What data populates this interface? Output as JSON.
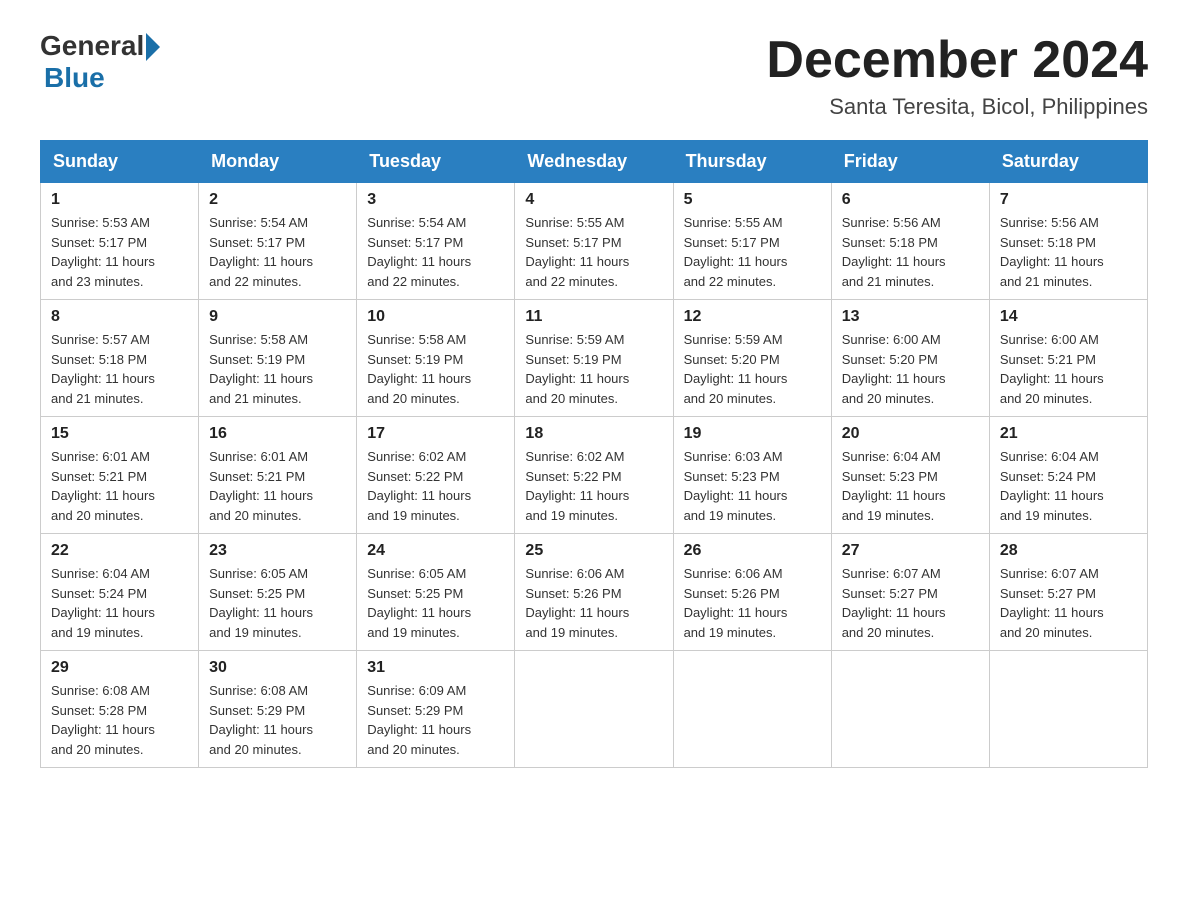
{
  "logo": {
    "general": "General",
    "blue": "Blue"
  },
  "title": "December 2024",
  "subtitle": "Santa Teresita, Bicol, Philippines",
  "days_of_week": [
    "Sunday",
    "Monday",
    "Tuesday",
    "Wednesday",
    "Thursday",
    "Friday",
    "Saturday"
  ],
  "weeks": [
    [
      {
        "day": "1",
        "sunrise": "5:53 AM",
        "sunset": "5:17 PM",
        "daylight": "11 hours and 23 minutes."
      },
      {
        "day": "2",
        "sunrise": "5:54 AM",
        "sunset": "5:17 PM",
        "daylight": "11 hours and 22 minutes."
      },
      {
        "day": "3",
        "sunrise": "5:54 AM",
        "sunset": "5:17 PM",
        "daylight": "11 hours and 22 minutes."
      },
      {
        "day": "4",
        "sunrise": "5:55 AM",
        "sunset": "5:17 PM",
        "daylight": "11 hours and 22 minutes."
      },
      {
        "day": "5",
        "sunrise": "5:55 AM",
        "sunset": "5:17 PM",
        "daylight": "11 hours and 22 minutes."
      },
      {
        "day": "6",
        "sunrise": "5:56 AM",
        "sunset": "5:18 PM",
        "daylight": "11 hours and 21 minutes."
      },
      {
        "day": "7",
        "sunrise": "5:56 AM",
        "sunset": "5:18 PM",
        "daylight": "11 hours and 21 minutes."
      }
    ],
    [
      {
        "day": "8",
        "sunrise": "5:57 AM",
        "sunset": "5:18 PM",
        "daylight": "11 hours and 21 minutes."
      },
      {
        "day": "9",
        "sunrise": "5:58 AM",
        "sunset": "5:19 PM",
        "daylight": "11 hours and 21 minutes."
      },
      {
        "day": "10",
        "sunrise": "5:58 AM",
        "sunset": "5:19 PM",
        "daylight": "11 hours and 20 minutes."
      },
      {
        "day": "11",
        "sunrise": "5:59 AM",
        "sunset": "5:19 PM",
        "daylight": "11 hours and 20 minutes."
      },
      {
        "day": "12",
        "sunrise": "5:59 AM",
        "sunset": "5:20 PM",
        "daylight": "11 hours and 20 minutes."
      },
      {
        "day": "13",
        "sunrise": "6:00 AM",
        "sunset": "5:20 PM",
        "daylight": "11 hours and 20 minutes."
      },
      {
        "day": "14",
        "sunrise": "6:00 AM",
        "sunset": "5:21 PM",
        "daylight": "11 hours and 20 minutes."
      }
    ],
    [
      {
        "day": "15",
        "sunrise": "6:01 AM",
        "sunset": "5:21 PM",
        "daylight": "11 hours and 20 minutes."
      },
      {
        "day": "16",
        "sunrise": "6:01 AM",
        "sunset": "5:21 PM",
        "daylight": "11 hours and 20 minutes."
      },
      {
        "day": "17",
        "sunrise": "6:02 AM",
        "sunset": "5:22 PM",
        "daylight": "11 hours and 19 minutes."
      },
      {
        "day": "18",
        "sunrise": "6:02 AM",
        "sunset": "5:22 PM",
        "daylight": "11 hours and 19 minutes."
      },
      {
        "day": "19",
        "sunrise": "6:03 AM",
        "sunset": "5:23 PM",
        "daylight": "11 hours and 19 minutes."
      },
      {
        "day": "20",
        "sunrise": "6:04 AM",
        "sunset": "5:23 PM",
        "daylight": "11 hours and 19 minutes."
      },
      {
        "day": "21",
        "sunrise": "6:04 AM",
        "sunset": "5:24 PM",
        "daylight": "11 hours and 19 minutes."
      }
    ],
    [
      {
        "day": "22",
        "sunrise": "6:04 AM",
        "sunset": "5:24 PM",
        "daylight": "11 hours and 19 minutes."
      },
      {
        "day": "23",
        "sunrise": "6:05 AM",
        "sunset": "5:25 PM",
        "daylight": "11 hours and 19 minutes."
      },
      {
        "day": "24",
        "sunrise": "6:05 AM",
        "sunset": "5:25 PM",
        "daylight": "11 hours and 19 minutes."
      },
      {
        "day": "25",
        "sunrise": "6:06 AM",
        "sunset": "5:26 PM",
        "daylight": "11 hours and 19 minutes."
      },
      {
        "day": "26",
        "sunrise": "6:06 AM",
        "sunset": "5:26 PM",
        "daylight": "11 hours and 19 minutes."
      },
      {
        "day": "27",
        "sunrise": "6:07 AM",
        "sunset": "5:27 PM",
        "daylight": "11 hours and 20 minutes."
      },
      {
        "day": "28",
        "sunrise": "6:07 AM",
        "sunset": "5:27 PM",
        "daylight": "11 hours and 20 minutes."
      }
    ],
    [
      {
        "day": "29",
        "sunrise": "6:08 AM",
        "sunset": "5:28 PM",
        "daylight": "11 hours and 20 minutes."
      },
      {
        "day": "30",
        "sunrise": "6:08 AM",
        "sunset": "5:29 PM",
        "daylight": "11 hours and 20 minutes."
      },
      {
        "day": "31",
        "sunrise": "6:09 AM",
        "sunset": "5:29 PM",
        "daylight": "11 hours and 20 minutes."
      },
      null,
      null,
      null,
      null
    ]
  ]
}
